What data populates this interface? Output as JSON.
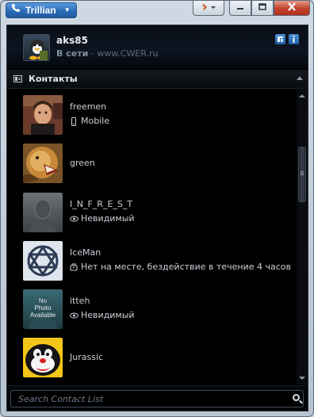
{
  "titlebar": {
    "app_name": "Trillian",
    "icons": {
      "app": "phone-icon",
      "menu": "dropdown-arrow-icon",
      "status": "status-icon",
      "minimize": "minimize-icon",
      "maximize": "maximize-icon",
      "close": "close-icon"
    }
  },
  "profile": {
    "name": "aks85",
    "status": "В сети",
    "separator": " - ",
    "message": "www.CWER.ru"
  },
  "section": {
    "title": "Контакты"
  },
  "contacts": [
    {
      "name": "freemen",
      "status": "Mobile",
      "status_icon": "mobile-icon"
    },
    {
      "name": "green",
      "status": "",
      "status_icon": ""
    },
    {
      "name": "I_N_F_R_E_S_T",
      "status": "Невидимый",
      "status_icon": "eye-icon"
    },
    {
      "name": "IceMan",
      "status": "Нет на месте, бездействие в течение 4 часов",
      "status_icon": "away-icon"
    },
    {
      "name": "itteh",
      "status": "Невидимый",
      "status_icon": "eye-icon"
    },
    {
      "name": "Jurassic",
      "status": "",
      "status_icon": ""
    }
  ],
  "avatar_texts": {
    "no_photo": "No Photo Available"
  },
  "search": {
    "placeholder": "Search Contact List",
    "value": ""
  },
  "colors": {
    "accent": "#2b6cb8",
    "close": "#c2412c",
    "background": "#000000"
  }
}
